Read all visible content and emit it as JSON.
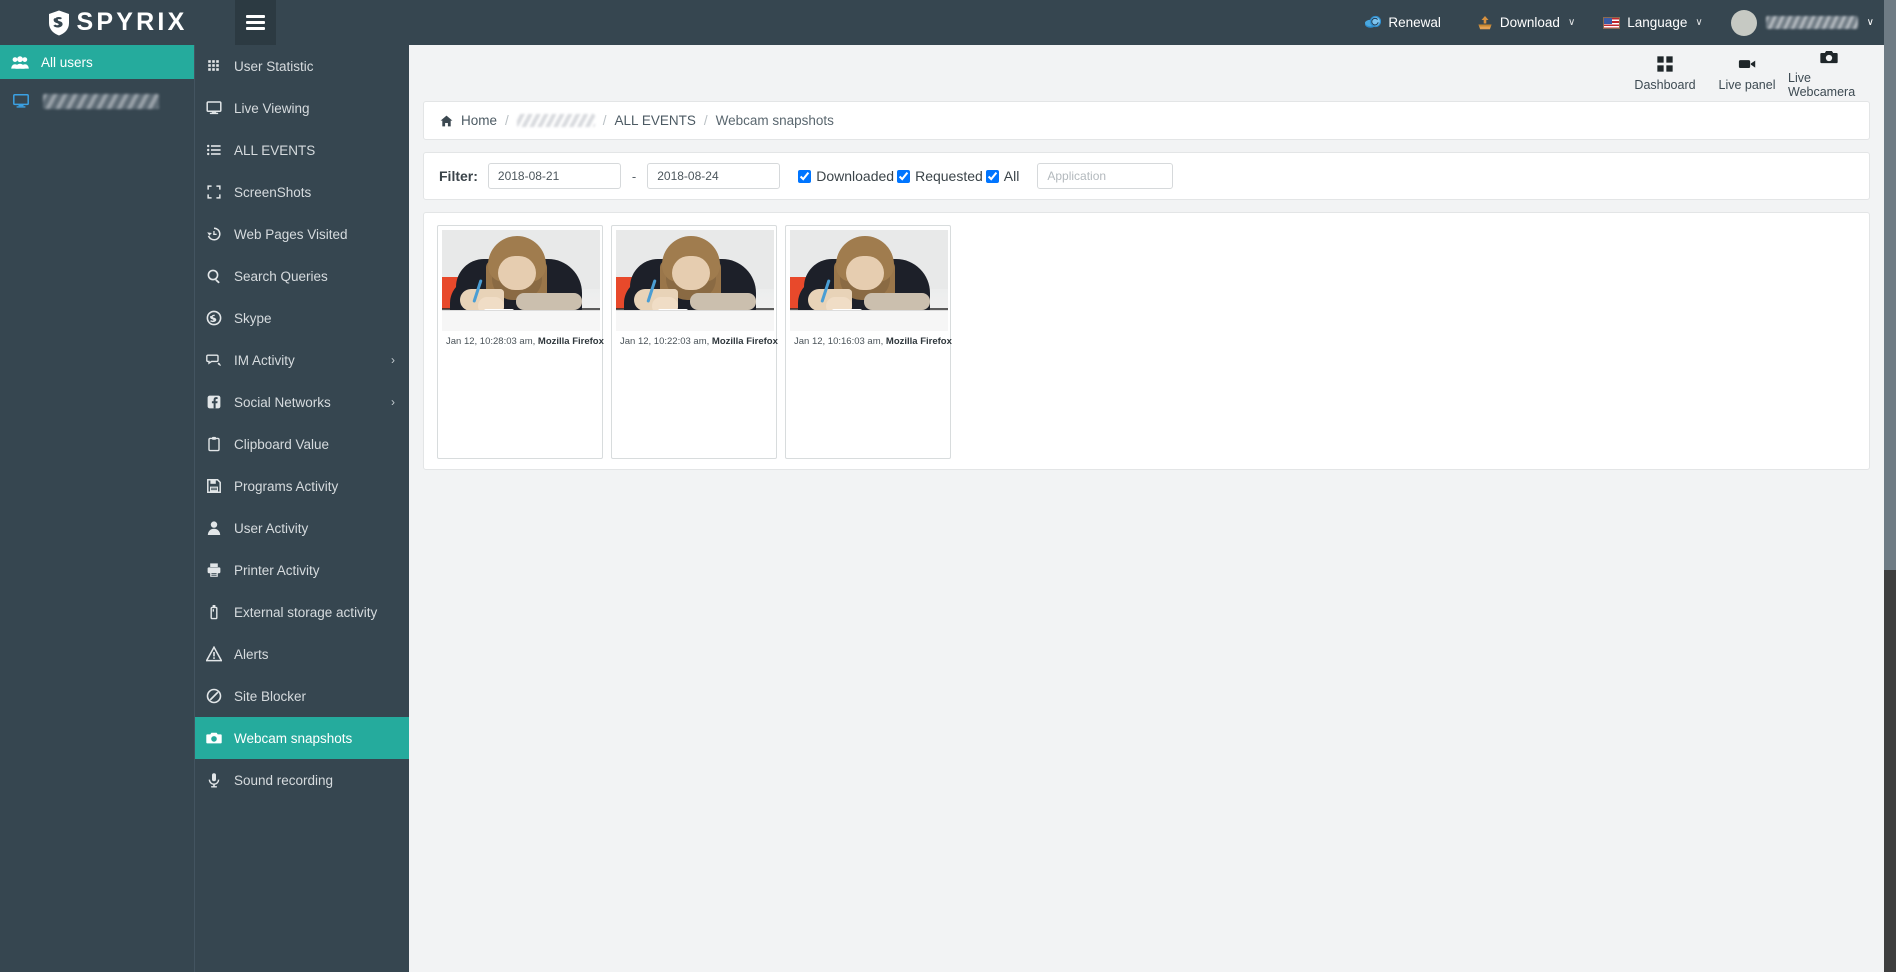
{
  "brand": {
    "name": "SPYRIX",
    "logo_icon": "shield-icon"
  },
  "topbar": {
    "menu_toggle_icon": "hamburger-icon",
    "items": [
      {
        "label": "Renewal",
        "icon": "renewal-coins-icon",
        "caret": ""
      },
      {
        "label": "Download",
        "icon": "download-icon",
        "caret": "∨"
      },
      {
        "label": "Language",
        "icon": "flag-us-icon",
        "caret": "∨"
      }
    ],
    "account": {
      "avatar_icon": "avatar",
      "name": "",
      "caret": "∨"
    }
  },
  "userpanel": {
    "all_users_label": "All users",
    "all_users_icon": "users-icon",
    "user_icon": "monitor-icon",
    "user_name": ""
  },
  "sidebar": {
    "items": [
      {
        "label": "User Statistic",
        "icon": "grid-icon",
        "active": false,
        "chevron": ""
      },
      {
        "label": "Live Viewing",
        "icon": "monitor-icon",
        "active": false,
        "chevron": ""
      },
      {
        "label": "ALL EVENTS",
        "icon": "list-icon",
        "active": false,
        "chevron": ""
      },
      {
        "label": "ScreenShots",
        "icon": "crop-frame-icon",
        "active": false,
        "chevron": ""
      },
      {
        "label": "Web Pages Visited",
        "icon": "history-icon",
        "active": false,
        "chevron": ""
      },
      {
        "label": "Search Queries",
        "icon": "search-icon",
        "active": false,
        "chevron": ""
      },
      {
        "label": "Skype",
        "icon": "skype-icon",
        "active": false,
        "chevron": ""
      },
      {
        "label": "IM Activity",
        "icon": "chat-icon",
        "active": false,
        "chevron": "›"
      },
      {
        "label": "Social Networks",
        "icon": "facebook-icon",
        "active": false,
        "chevron": "›"
      },
      {
        "label": "Clipboard Value",
        "icon": "clipboard-icon",
        "active": false,
        "chevron": ""
      },
      {
        "label": "Programs Activity",
        "icon": "floppy-save-icon",
        "active": false,
        "chevron": ""
      },
      {
        "label": "User Activity",
        "icon": "user-icon",
        "active": false,
        "chevron": ""
      },
      {
        "label": "Printer Activity",
        "icon": "printer-icon",
        "active": false,
        "chevron": ""
      },
      {
        "label": "External storage activity",
        "icon": "usb-drive-icon",
        "active": false,
        "chevron": ""
      },
      {
        "label": "Alerts",
        "icon": "warning-icon",
        "active": false,
        "chevron": ""
      },
      {
        "label": "Site Blocker",
        "icon": "block-icon",
        "active": false,
        "chevron": ""
      },
      {
        "label": "Webcam snapshots",
        "icon": "camera-icon",
        "active": true,
        "chevron": ""
      },
      {
        "label": "Sound recording",
        "icon": "microphone-icon",
        "active": false,
        "chevron": ""
      }
    ]
  },
  "quicknav": {
    "items": [
      {
        "label": "Dashboard",
        "icon": "grid-squares-icon"
      },
      {
        "label": "Live panel",
        "icon": "video-camera-icon"
      },
      {
        "label": "Live Webcamera",
        "icon": "photo-camera-icon"
      }
    ]
  },
  "breadcrumb": {
    "home_icon": "home-icon",
    "home": "Home",
    "separator": "/",
    "masked_item": "",
    "events": "ALL EVENTS",
    "current": "Webcam snapshots"
  },
  "filter": {
    "label": "Filter:",
    "date_from": "2018-08-21",
    "date_from_placeholder": "",
    "dash": "-",
    "date_to": "2018-08-24",
    "date_to_placeholder": "",
    "checkboxes": [
      {
        "label": "Downloaded",
        "checked": true
      },
      {
        "label": "Requested",
        "checked": true
      },
      {
        "label": "All",
        "checked": true
      }
    ],
    "application_value": "",
    "application_placeholder": "Application"
  },
  "gallery": {
    "snapshots": [
      {
        "time": "Jan 12, 10:28:03 am, ",
        "app": "Mozilla Firefox"
      },
      {
        "time": "Jan 12, 10:22:03 am, ",
        "app": "Mozilla Firefox"
      },
      {
        "time": "Jan 12, 10:16:03 am, ",
        "app": "Mozilla Firefox"
      }
    ]
  },
  "colors": {
    "accent_teal": "#25ab9d",
    "sidebar_dark": "#364650",
    "topbar_dark": "#364650",
    "hamburger_dark": "#2c3a42",
    "content_bg": "#f2f3f4",
    "card_white": "#ffffff"
  }
}
